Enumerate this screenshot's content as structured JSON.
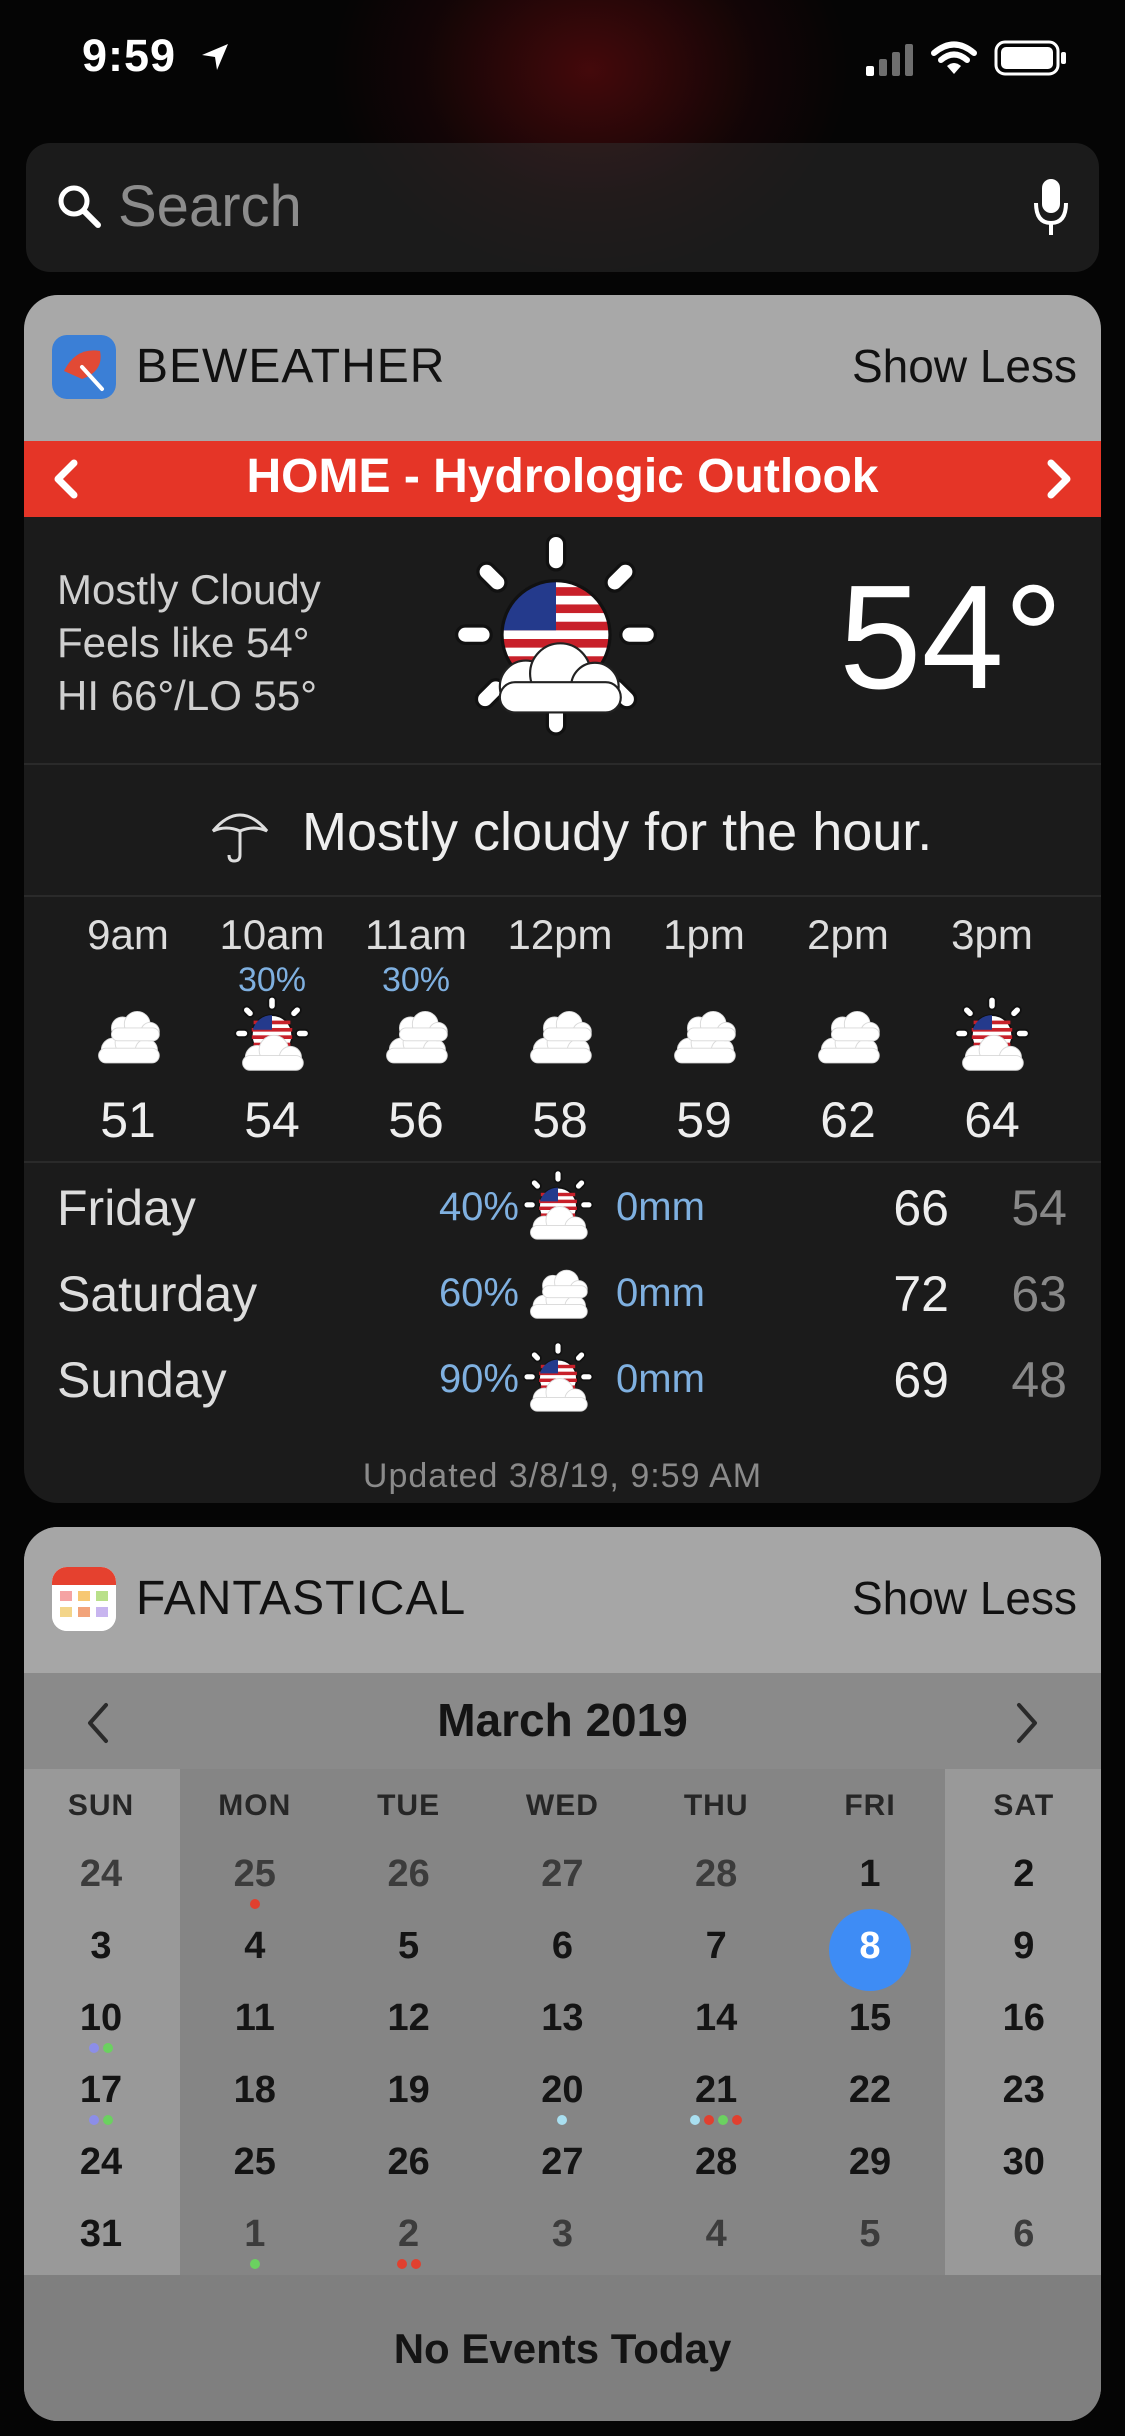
{
  "status": {
    "time": "9:59"
  },
  "search": {
    "placeholder": "Search"
  },
  "beweather": {
    "app_name": "BEWEATHER",
    "show_less": "Show Less",
    "location_title": "HOME - Hydrologic Outlook",
    "current": {
      "condition": "Mostly Cloudy",
      "feels_like": "Feels like 54°",
      "hi_lo": "HI 66°/LO 55°",
      "temperature": "54°",
      "icon": "partly-cloudy-flag-sun-icon"
    },
    "hour_summary": "Mostly cloudy for the hour.",
    "hourly": [
      {
        "time": "9am",
        "precip": "",
        "temp": "51",
        "icon": "cloudy-icon"
      },
      {
        "time": "10am",
        "precip": "30%",
        "temp": "54",
        "icon": "partly-cloudy-icon"
      },
      {
        "time": "11am",
        "precip": "30%",
        "temp": "56",
        "icon": "cloudy-icon"
      },
      {
        "time": "12pm",
        "precip": "",
        "temp": "58",
        "icon": "cloudy-icon"
      },
      {
        "time": "1pm",
        "precip": "",
        "temp": "59",
        "icon": "cloudy-icon"
      },
      {
        "time": "2pm",
        "precip": "",
        "temp": "62",
        "icon": "cloudy-icon"
      },
      {
        "time": "3pm",
        "precip": "",
        "temp": "64",
        "icon": "partly-cloudy-icon"
      }
    ],
    "daily": [
      {
        "day": "Friday",
        "precip": "40%",
        "rain": "0mm",
        "hi": "66",
        "lo": "54",
        "icon": "partly-cloudy-icon"
      },
      {
        "day": "Saturday",
        "precip": "60%",
        "rain": "0mm",
        "hi": "72",
        "lo": "63",
        "icon": "cloudy-icon"
      },
      {
        "day": "Sunday",
        "precip": "90%",
        "rain": "0mm",
        "hi": "69",
        "lo": "48",
        "icon": "partly-cloudy-icon"
      }
    ],
    "updated": "Updated 3/8/19, 9:59 AM"
  },
  "fantastical": {
    "app_name": "FANTASTICAL",
    "show_less": "Show Less",
    "month": "March 2019",
    "weekdays": [
      "SUN",
      "MON",
      "TUE",
      "WED",
      "THU",
      "FRI",
      "SAT"
    ],
    "weeks": [
      [
        {
          "d": "24",
          "dim": true
        },
        {
          "d": "25",
          "dim": true,
          "dots": [
            "#e0402f"
          ]
        },
        {
          "d": "26",
          "dim": true
        },
        {
          "d": "27",
          "dim": true
        },
        {
          "d": "28",
          "dim": true
        },
        {
          "d": "1"
        },
        {
          "d": "2"
        }
      ],
      [
        {
          "d": "3"
        },
        {
          "d": "4"
        },
        {
          "d": "5"
        },
        {
          "d": "6"
        },
        {
          "d": "7"
        },
        {
          "d": "8",
          "today": true
        },
        {
          "d": "9"
        }
      ],
      [
        {
          "d": "10",
          "dots": [
            "#8c8ee8",
            "#6bd160"
          ]
        },
        {
          "d": "11"
        },
        {
          "d": "12"
        },
        {
          "d": "13"
        },
        {
          "d": "14"
        },
        {
          "d": "15"
        },
        {
          "d": "16"
        }
      ],
      [
        {
          "d": "17",
          "dots": [
            "#8c8ee8",
            "#6bd160"
          ]
        },
        {
          "d": "18"
        },
        {
          "d": "19"
        },
        {
          "d": "20",
          "dots": [
            "#a9dff0"
          ]
        },
        {
          "d": "21",
          "dots": [
            "#a9dff0",
            "#e0402f",
            "#6bd160",
            "#e0402f"
          ]
        },
        {
          "d": "22"
        },
        {
          "d": "23"
        }
      ],
      [
        {
          "d": "24"
        },
        {
          "d": "25"
        },
        {
          "d": "26"
        },
        {
          "d": "27"
        },
        {
          "d": "28"
        },
        {
          "d": "29"
        },
        {
          "d": "30"
        }
      ],
      [
        {
          "d": "31"
        },
        {
          "d": "1",
          "dim": true,
          "dots": [
            "#6bd160"
          ]
        },
        {
          "d": "2",
          "dim": true,
          "dots": [
            "#e0402f",
            "#e0402f"
          ]
        },
        {
          "d": "3",
          "dim": true
        },
        {
          "d": "4",
          "dim": true
        },
        {
          "d": "5",
          "dim": true
        },
        {
          "d": "6",
          "dim": true
        }
      ]
    ],
    "no_events": "No Events Today",
    "today_color": "#3e8cf5"
  },
  "colors": {
    "beweather_header": "#e53527",
    "precip_blue": "#7fb0e0"
  }
}
